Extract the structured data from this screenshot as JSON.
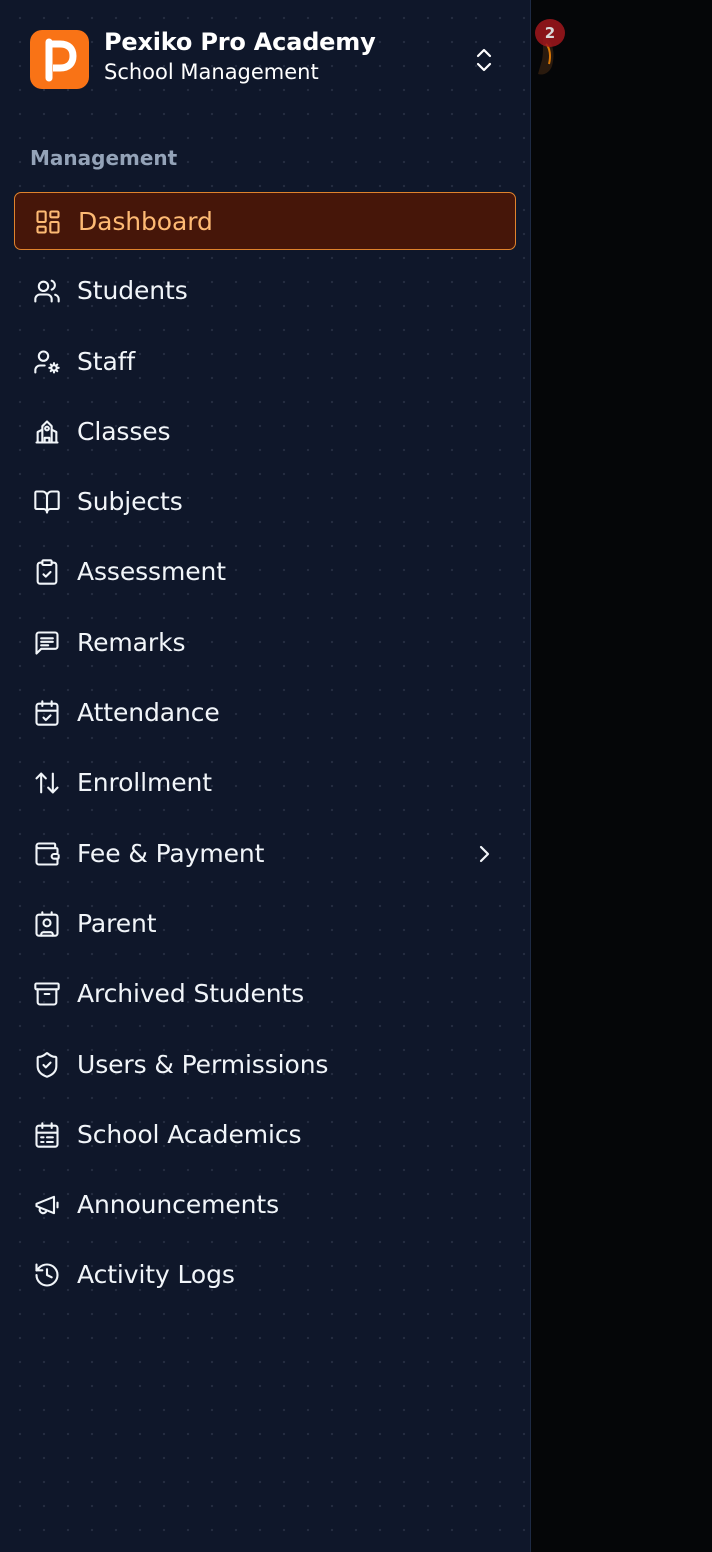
{
  "brand": {
    "name": "Pexiko Pro Academy",
    "subtitle": "School Management",
    "logo_letter": "P",
    "logo_color": "#f97316"
  },
  "background": {
    "notification_count": "2"
  },
  "section": {
    "label": "Management"
  },
  "nav": {
    "items": [
      {
        "label": "Dashboard",
        "icon": "dashboard-icon",
        "active": true
      },
      {
        "label": "Students",
        "icon": "users-icon"
      },
      {
        "label": "Staff",
        "icon": "user-cog-icon"
      },
      {
        "label": "Classes",
        "icon": "school-icon"
      },
      {
        "label": "Subjects",
        "icon": "book-open-icon"
      },
      {
        "label": "Assessment",
        "icon": "clipboard-check-icon"
      },
      {
        "label": "Remarks",
        "icon": "message-lines-icon"
      },
      {
        "label": "Attendance",
        "icon": "calendar-check-icon"
      },
      {
        "label": "Enrollment",
        "icon": "arrows-up-down-icon"
      },
      {
        "label": "Fee & Payment",
        "icon": "wallet-icon",
        "has_submenu": true
      },
      {
        "label": "Parent",
        "icon": "contact-icon"
      },
      {
        "label": "Archived Students",
        "icon": "archive-icon"
      },
      {
        "label": "Users & Permissions",
        "icon": "shield-check-icon"
      },
      {
        "label": "School Academics",
        "icon": "calendar-list-icon"
      },
      {
        "label": "Announcements",
        "icon": "megaphone-icon"
      },
      {
        "label": "Activity Logs",
        "icon": "history-icon"
      }
    ]
  },
  "colors": {
    "sidebar_bg": "#0f172a",
    "active_bg": "#461609",
    "active_border": "#e0832d",
    "active_text": "#fdba74",
    "accent": "#f97316"
  }
}
